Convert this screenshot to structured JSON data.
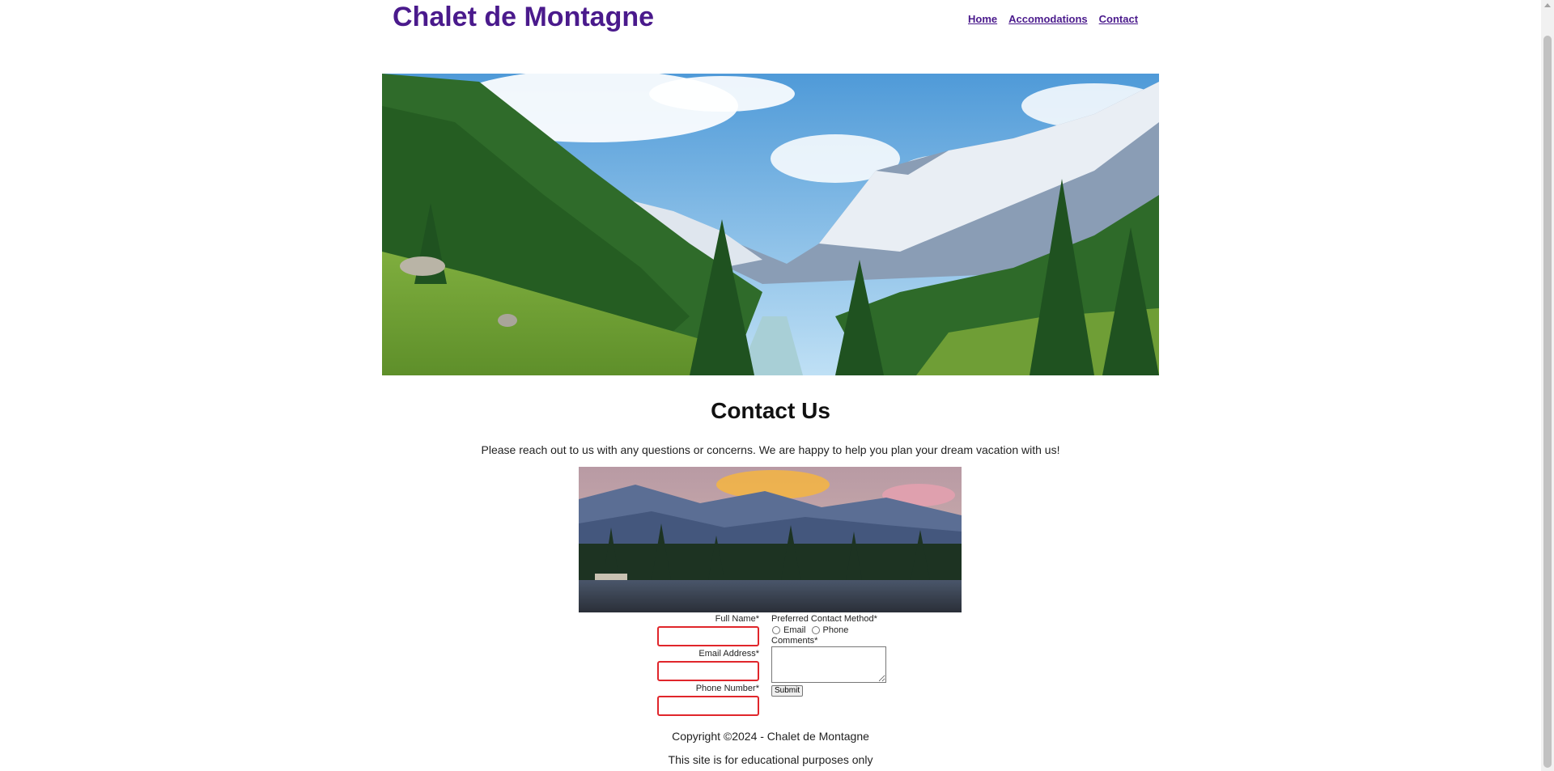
{
  "header": {
    "site_title": "Chalet de Montagne",
    "nav": [
      "Home",
      "Accomodations",
      "Contact"
    ]
  },
  "colors": {
    "brand": "#4a1a8c",
    "input_border": "#e0262b"
  },
  "hero": {
    "alt": "Alpine valley with pine forest, river and snowy peaks"
  },
  "contact": {
    "heading": "Contact Us",
    "intro": "Please reach out to us with any questions or concerns. We are happy to help you plan your dream vacation with us!",
    "image_alt": "Mountain lake at sunset with pine trees"
  },
  "form": {
    "full_name_label": "Full Name*",
    "full_name_value": "",
    "email_label": "Email Address*",
    "email_value": "",
    "phone_label": "Phone Number*",
    "phone_value": "",
    "preferred_label": "Preferred Contact Method*",
    "option_email": "Email",
    "option_phone": "Phone",
    "comments_label": "Comments*",
    "comments_value": "",
    "submit_label": "Submit"
  },
  "footer": {
    "copyright": "Copyright ©2024 - Chalet de Montagne",
    "disclaimer": "This site is for educational purposes only"
  }
}
